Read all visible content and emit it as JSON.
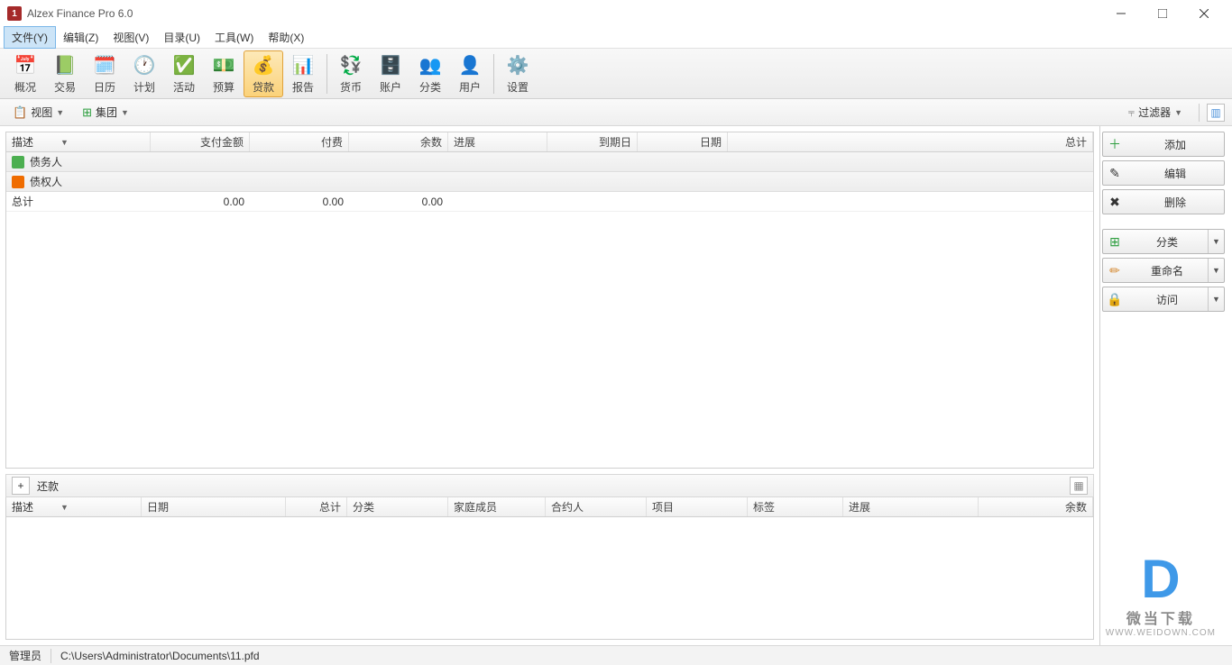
{
  "app": {
    "title": "Alzex Finance Pro 6.0",
    "icon": "1"
  },
  "menu": {
    "file": "文件(Y)",
    "edit": "编辑(Z)",
    "view": "视图(V)",
    "catalog": "目录(U)",
    "tools": "工具(W)",
    "help": "帮助(X)"
  },
  "toolbar": {
    "overview": "概况",
    "transaction": "交易",
    "calendar": "日历",
    "plan": "计划",
    "activity": "活动",
    "budget": "预算",
    "loan": "贷款",
    "report": "报告",
    "currency": "货币",
    "account": "账户",
    "category": "分类",
    "user": "用户",
    "settings": "设置"
  },
  "subbar": {
    "view_label": "视图",
    "group_label": "集团",
    "filter_label": "过滤器"
  },
  "upperGrid": {
    "headers": {
      "desc": "描述",
      "payamount": "支付金额",
      "fee": "付费",
      "remain": "余数",
      "progress": "进展",
      "duedate": "到期日",
      "date": "日期",
      "total": "总计"
    },
    "groups": {
      "debtor": "债务人",
      "creditor": "债权人"
    },
    "totalRow": {
      "label": "总计",
      "payamount": "0.00",
      "fee": "0.00",
      "remain": "0.00"
    }
  },
  "sidebar": {
    "add": "添加",
    "edit": "编辑",
    "delete": "删除",
    "category": "分类",
    "rename": "重命名",
    "access": "访问"
  },
  "lowerbar": {
    "title": "还款"
  },
  "lowerGrid": {
    "headers": {
      "desc": "描述",
      "date": "日期",
      "total": "总计",
      "category": "分类",
      "family": "家庭成员",
      "contractor": "合约人",
      "project": "项目",
      "tag": "标签",
      "progress": "进展",
      "remain": "余数"
    }
  },
  "status": {
    "user": "管理员",
    "path": "C:\\Users\\Administrator\\Documents\\11.pfd"
  },
  "watermark": {
    "logo": "D",
    "text1": "微当下载",
    "text2": "WWW.WEIDOWN.COM"
  }
}
